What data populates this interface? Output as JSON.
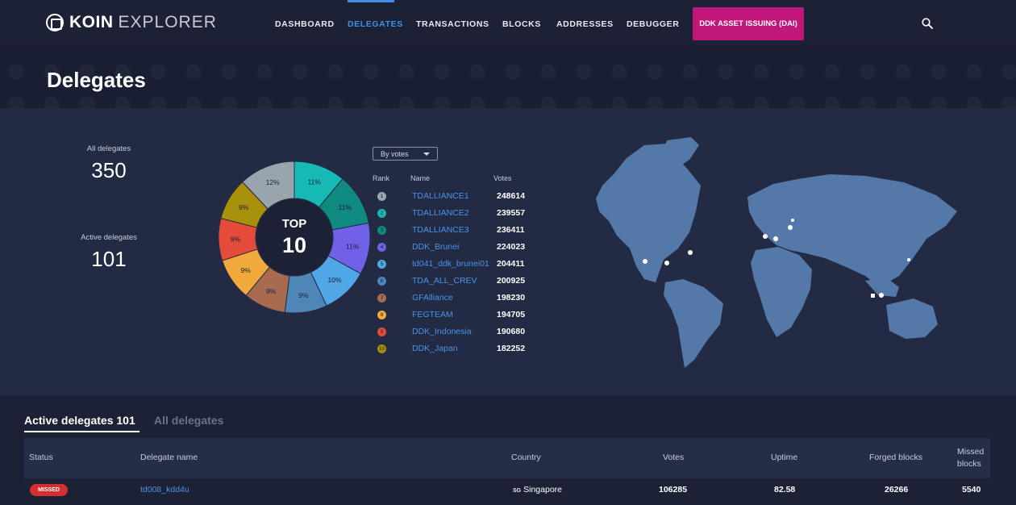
{
  "brand": {
    "name_bold": "KOIN",
    "name_light": "EXPLORER"
  },
  "nav": {
    "items": [
      "DASHBOARD",
      "DELEGATES",
      "TRANSACTIONS",
      "BLOCKS",
      "ADDRESSES",
      "DEBUGGER"
    ],
    "active": "DELEGATES",
    "cta": "DDK ASSET ISSUING (DAI)",
    "search_icon": "search-icon"
  },
  "page": {
    "title": "Delegates"
  },
  "stats": {
    "all_label": "All delegates",
    "all_value": "350",
    "active_label": "Active delegates",
    "active_value": "101"
  },
  "top10": {
    "center_line1": "TOP",
    "center_line2": "10",
    "sort_label": "By votes",
    "headers": {
      "rank": "Rank",
      "name": "Name",
      "votes": "Votes"
    },
    "rows": [
      {
        "rank": "1",
        "name": "TDALLIANCE1",
        "votes": "248614",
        "color": "#9aa4ad"
      },
      {
        "rank": "2",
        "name": "TDALLIANCE2",
        "votes": "239557",
        "color": "#17b9b5"
      },
      {
        "rank": "3",
        "name": "TDALLIANCE3",
        "votes": "236411",
        "color": "#0e8a80"
      },
      {
        "rank": "4",
        "name": "DDK_Brunei",
        "votes": "224023",
        "color": "#7061e6"
      },
      {
        "rank": "5",
        "name": "td041_ddk_brunei01",
        "votes": "204411",
        "color": "#4fa7e6"
      },
      {
        "rank": "6",
        "name": "TDA_ALL_CREV",
        "votes": "200925",
        "color": "#4f86b8"
      },
      {
        "rank": "7",
        "name": "GFAlliance",
        "votes": "198230",
        "color": "#a86b50"
      },
      {
        "rank": "8",
        "name": "FEGTEAM",
        "votes": "194705",
        "color": "#f2a93b"
      },
      {
        "rank": "9",
        "name": "DDK_Indonesia",
        "votes": "190680",
        "color": "#e54b3a"
      },
      {
        "rank": "10",
        "name": "DDK_Japan",
        "votes": "182252",
        "color": "#a8900a"
      }
    ]
  },
  "chart_data": {
    "type": "pie",
    "categories": [
      "TDALLIANCE1",
      "TDALLIANCE2",
      "TDALLIANCE3",
      "DDK_Brunei",
      "td041_ddk_brunei01",
      "TDA_ALL_CREV",
      "GFAlliance",
      "FEGTEAM",
      "DDK_Indonesia",
      "DDK_Japan"
    ],
    "values": [
      12,
      11,
      11,
      11,
      10,
      9,
      9,
      9,
      9,
      9
    ],
    "labels": [
      "12%",
      "11%",
      "11%",
      "11%",
      "10%",
      "9%",
      "9%",
      "9%",
      "9%",
      "9%"
    ],
    "colors": [
      "#9aa4ad",
      "#17b9b5",
      "#0e8a80",
      "#7061e6",
      "#4fa7e6",
      "#4f86b8",
      "#a86b50",
      "#f2a93b",
      "#e54b3a",
      "#a8900a"
    ],
    "order": [
      1,
      2,
      3,
      4,
      5,
      6,
      7,
      8,
      9,
      0
    ],
    "donut": true
  },
  "tabs": {
    "active": "Active delegates 101",
    "inactive": "All delegates"
  },
  "table": {
    "headers": {
      "status": "Status",
      "name": "Delegate name",
      "country": "Country",
      "votes": "Votes",
      "uptime": "Uptime",
      "forged": "Forged blocks",
      "missed_1": "Missed",
      "missed_2": "blocks"
    },
    "rows": [
      {
        "status": "MISSED",
        "name": "td008_kdd4u",
        "country_code": "SG",
        "country": "Singapore",
        "votes": "106285",
        "uptime": "82.58",
        "forged": "26266",
        "missed": "5540"
      }
    ]
  }
}
